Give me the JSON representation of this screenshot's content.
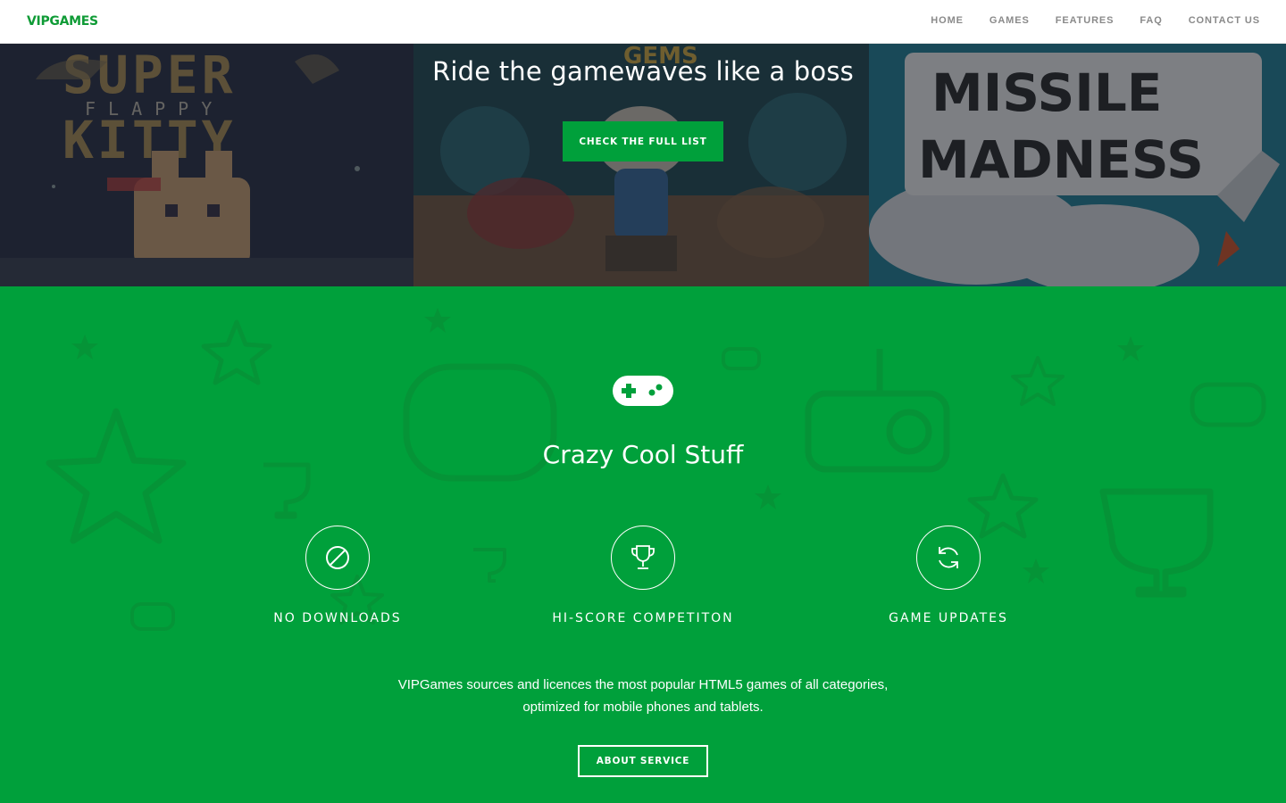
{
  "brand": {
    "name": "VIPGAMES",
    "color": "#0f9b36"
  },
  "nav": {
    "items": [
      {
        "label": "HOME"
      },
      {
        "label": "GAMES"
      },
      {
        "label": "FEATURES"
      },
      {
        "label": "FAQ"
      },
      {
        "label": "CONTACT US"
      }
    ]
  },
  "hero": {
    "title": "Ride the gamewaves like a boss",
    "button_label": "CHECK THE FULL LIST",
    "panels": [
      {
        "icon": "super-flappy-kitty-game-art"
      },
      {
        "icon": "gems-game-art"
      },
      {
        "icon": "missile-madness-game-art"
      }
    ]
  },
  "features": {
    "icon": "gamepad-icon",
    "title": "Crazy Cool Stuff",
    "items": [
      {
        "label": "NO DOWNLOADS",
        "icon": "no-download-icon"
      },
      {
        "label": "HI-SCORE COMPETITON",
        "icon": "trophy-icon"
      },
      {
        "label": "GAME UPDATES",
        "icon": "refresh-icon"
      }
    ],
    "description_line1": "VIPGames sources and licences the most popular HTML5 games of all categories,",
    "description_line2": "optimized for mobile phones and tablets.",
    "button_label": "ABOUT SERVICE"
  },
  "colors": {
    "accent": "#00a03b",
    "white": "#ffffff",
    "nav_text": "#8a8a8a"
  }
}
